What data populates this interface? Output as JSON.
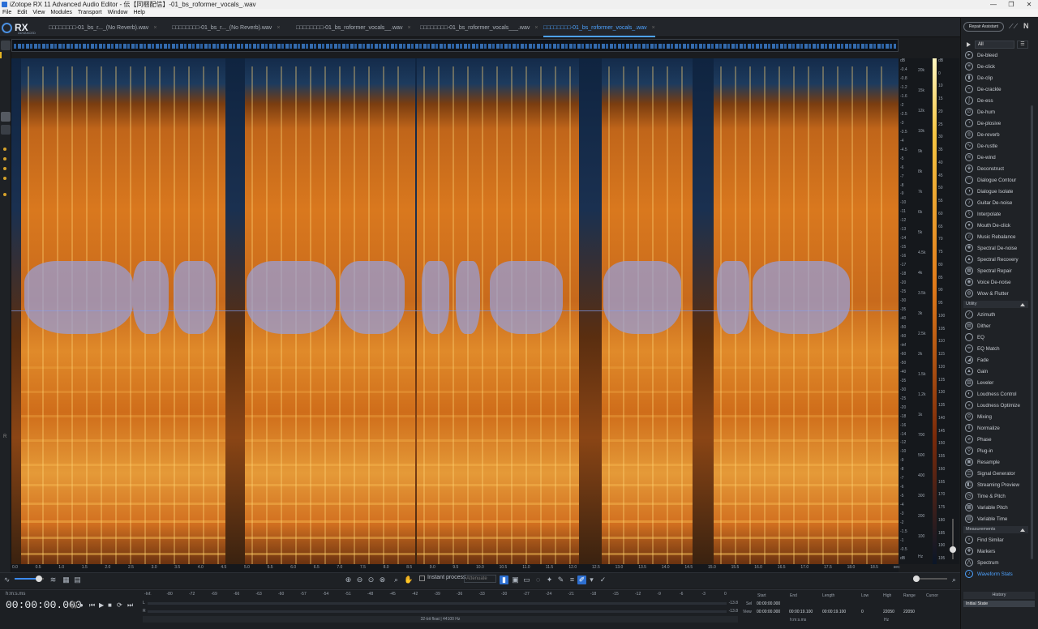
{
  "window": {
    "title": "iZotope RX 11 Advanced Audio Editor - 伝【同梱配信】-01_bs_roformer_vocals_.wav",
    "controls": [
      "—",
      "❐",
      "✕"
    ]
  },
  "menu": [
    "File",
    "Edit",
    "View",
    "Modules",
    "Transport",
    "Window",
    "Help"
  ],
  "logo": {
    "name": "RX",
    "sub": "ADVANCED"
  },
  "file_tabs": [
    {
      "label": "□□□□□□□□-01_bs_r..._(No Reverb).wav",
      "active": false
    },
    {
      "label": "□□□□□□□□-01_bs_r..._(No Reverb).wav",
      "active": false
    },
    {
      "label": "□□□□□□□□-01_bs_roformer_vocals__.wav",
      "active": false
    },
    {
      "label": "□□□□□□□□-01_bs_roformer_vocals___.wav",
      "active": false
    },
    {
      "label": "□□□□□□□□-01_bs_roformer_vocals_.wav",
      "active": true
    }
  ],
  "left_rail": {
    "channel_label": "R"
  },
  "db_scale": [
    "dB",
    "-0.4",
    "-0.8",
    "-1.2",
    "-1.6",
    "-2",
    "-2.5",
    "-3",
    "-3.5",
    "-4",
    "-4.5",
    "-5",
    "-6",
    "-7",
    "-8",
    "-9",
    "-10",
    "-11",
    "-12",
    "-13",
    "-14",
    "-15",
    "-16",
    "-17",
    "-18",
    "-20",
    "-25",
    "-30",
    "-35",
    "-40",
    "-50",
    "-60",
    "-inf",
    "-60",
    "-50",
    "-40",
    "-35",
    "-30",
    "-25",
    "-20",
    "-18",
    "-16",
    "-14",
    "-12",
    "-10",
    "-9",
    "-8",
    "-7",
    "-6",
    "-5",
    "-4",
    "-3",
    "-2",
    "-1.5",
    "-1",
    "-0.5",
    "dB"
  ],
  "hz_scale": [
    "20k",
    "15k",
    "12k",
    "10k",
    "9k",
    "8k",
    "7k",
    "6k",
    "5k",
    "4.5k",
    "4k",
    "3.5k",
    "3k",
    "2.5k",
    "2k",
    "1.5k",
    "1.2k",
    "1k",
    "700",
    "500",
    "400",
    "300",
    "200",
    "100",
    "Hz"
  ],
  "level_scale": [
    "dB",
    "0",
    "10",
    "15",
    "20",
    "25",
    "30",
    "35",
    "40",
    "45",
    "50",
    "55",
    "60",
    "65",
    "70",
    "75",
    "80",
    "85",
    "90",
    "95",
    "100",
    "105",
    "110",
    "115",
    "120",
    "125",
    "130",
    "135",
    "140",
    "145",
    "150",
    "155",
    "160",
    "165",
    "170",
    "175",
    "180",
    "185",
    "190",
    "195"
  ],
  "time_axis": [
    "0.0",
    "0.5",
    "1.0",
    "1.5",
    "2.0",
    "2.5",
    "3.0",
    "3.5",
    "4.0",
    "4.5",
    "5.0",
    "5.5",
    "6.0",
    "6.5",
    "7.0",
    "7.5",
    "8.0",
    "8.5",
    "9.0",
    "9.5",
    "10.0",
    "10.5",
    "11.0",
    "11.5",
    "12.0",
    "12.5",
    "13.0",
    "13.5",
    "14.0",
    "14.5",
    "15.0",
    "15.5",
    "16.0",
    "16.5",
    "17.0",
    "17.5",
    "18.0",
    "18.5",
    "sec"
  ],
  "toolbar": {
    "instant_process_label": "Instant process",
    "instant_mode": "Attenuate"
  },
  "transport": {
    "time_format": "h:m:s.ms",
    "timecode": "00:00:00.000"
  },
  "meter": {
    "ticks": [
      "-Inf.",
      "-80",
      "-72",
      "-69",
      "-66",
      "-63",
      "-60",
      "-57",
      "-54",
      "-51",
      "-48",
      "-45",
      "-42",
      "-39",
      "-36",
      "-33",
      "-30",
      "-27",
      "-24",
      "-21",
      "-18",
      "-15",
      "-12",
      "-9",
      "-6",
      "-3",
      "0"
    ],
    "left_label": "L",
    "right_label": "R",
    "peak_l": "-13.8",
    "peak_r": "-13.8",
    "format": "32-bit float | 44100 Hz"
  },
  "selection": {
    "headers": [
      "Start",
      "End",
      "Length",
      "Low",
      "High",
      "Range",
      "Cursor"
    ],
    "sel_label": "Sel",
    "view_label": "View",
    "sel_start": "00:00:00.000",
    "view_start": "00:00:00.000",
    "view_end": "00:00:19.100",
    "view_length": "00:00:19.100",
    "low": "0",
    "high": "22050",
    "range": "22050",
    "time_unit": "h:m:s.ms",
    "freq_unit": "Hz"
  },
  "right_panel": {
    "repair_assistant": "Repair Assistant",
    "filter": "All",
    "modules": [
      "De-bleed",
      "De-click",
      "De-clip",
      "De-crackle",
      "De-ess",
      "De-hum",
      "De-plosive",
      "De-reverb",
      "De-rustle",
      "De-wind",
      "Deconstruct",
      "Dialogue Contour",
      "Dialogue Isolate",
      "Guitar De-noise",
      "Interpolate",
      "Mouth De-click",
      "Music Rebalance",
      "Spectral De-noise",
      "Spectral Recovery",
      "Spectral Repair",
      "Voice De-noise",
      "Wow & Flutter"
    ],
    "utility_header": "Utility",
    "utility": [
      "Azimuth",
      "Dither",
      "EQ",
      "EQ Match",
      "Fade",
      "Gain",
      "Leveler",
      "Loudness Control",
      "Loudness Optimize",
      "Mixing",
      "Normalize",
      "Phase",
      "Plug-in",
      "Resample",
      "Signal Generator",
      "Streaming Preview",
      "Time & Pitch",
      "Variable Pitch",
      "Variable Time"
    ],
    "measurements_header": "Measurements",
    "measurements": [
      "Find Similar",
      "Markers",
      "Spectrum",
      "Waveform Stats"
    ],
    "history_header": "History",
    "history_state": "Initial State"
  }
}
